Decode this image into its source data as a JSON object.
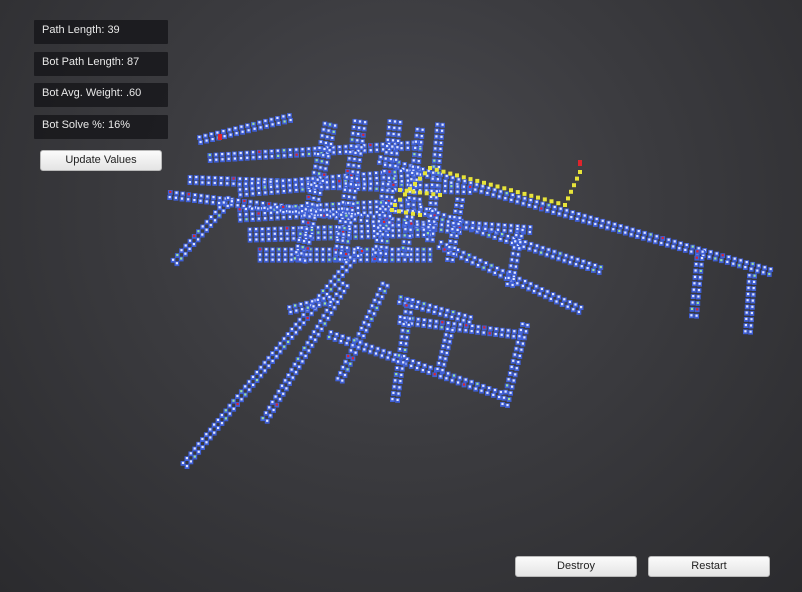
{
  "stats": {
    "path_length": "Path Length: 39",
    "bot_path_length": "Bot Path Length: 87",
    "bot_avg_weight": "Bot Avg. Weight: .60",
    "bot_solve": "Bot Solve %: 16%"
  },
  "buttons": {
    "update": "Update Values",
    "destroy": "Destroy",
    "restart": "Restart"
  },
  "maze": {
    "tile_color": "#3f5fd6",
    "tile_highlight": "#dfe6ff",
    "player_path_color": "#e8e43a",
    "marker_color": "#e0242c",
    "accent_color": "#9fe39a"
  }
}
